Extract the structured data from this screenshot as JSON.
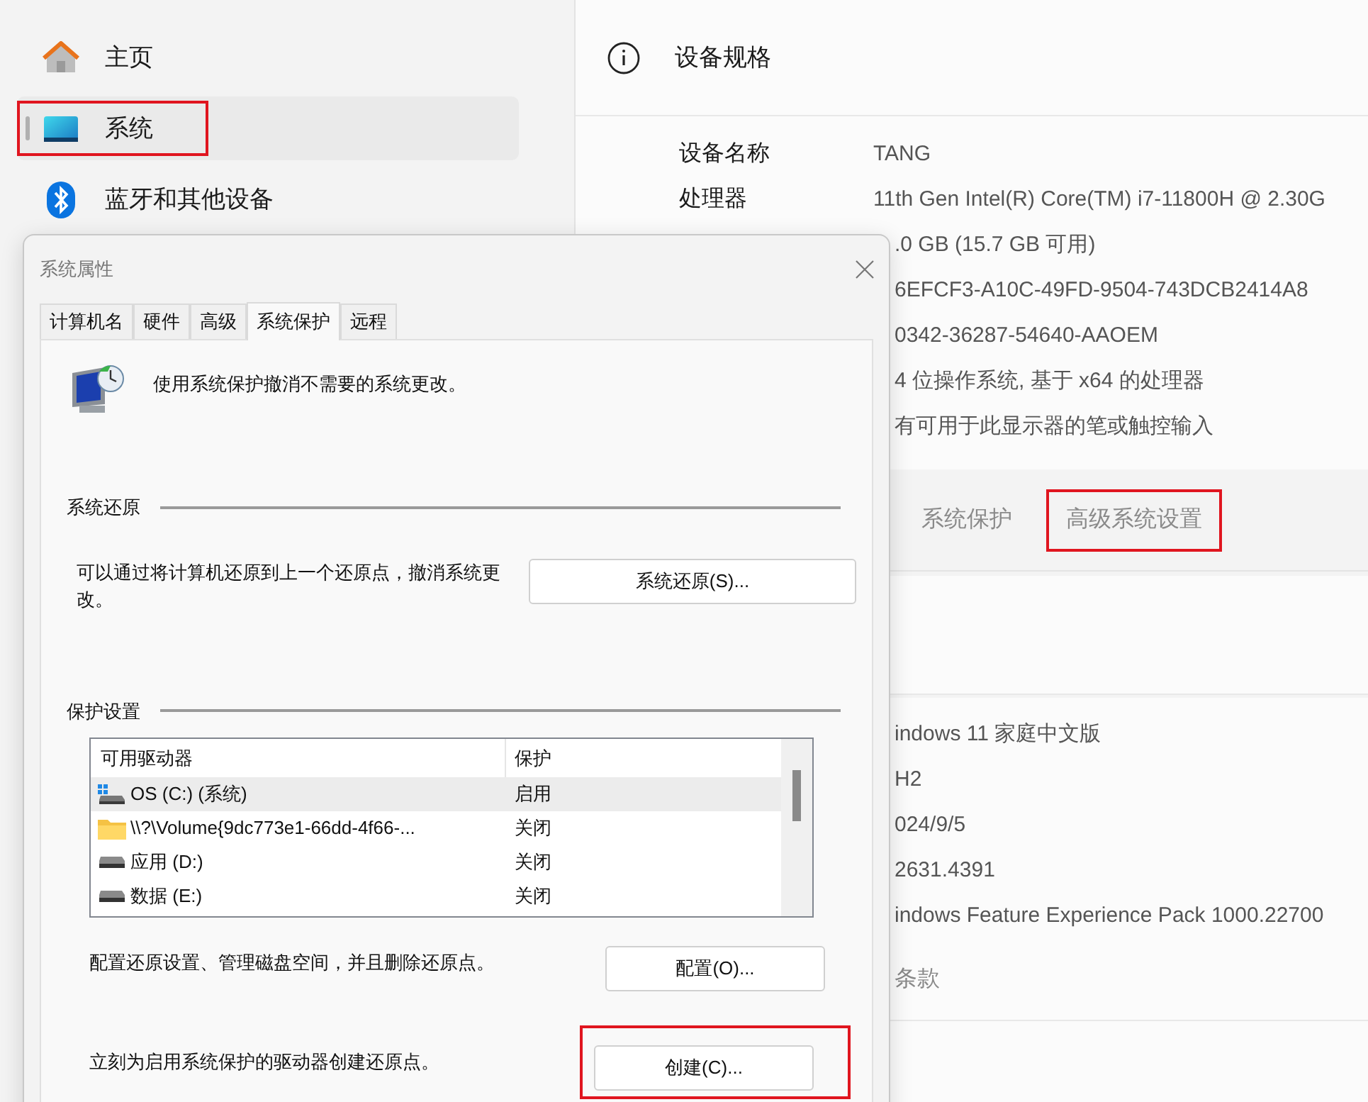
{
  "sidebar": {
    "items": [
      {
        "label": "主页",
        "kind": "home",
        "selected": false,
        "highlighted": false
      },
      {
        "label": "系统",
        "kind": "display",
        "selected": true,
        "highlighted": true
      },
      {
        "label": "蓝牙和其他设备",
        "kind": "bluetooth",
        "selected": false,
        "highlighted": false
      }
    ]
  },
  "spec_card": {
    "title": "设备规格",
    "rows": [
      {
        "label": "设备名称",
        "value": "TANG"
      },
      {
        "label": "处理器",
        "value": "11th Gen Intel(R) Core(TM) i7-11800H @ 2.30G"
      },
      {
        "value": ".0 GB (15.7 GB 可用)"
      },
      {
        "value": "6EFCF3-A10C-49FD-9504-743DCB2414A8"
      },
      {
        "value": "0342-36287-54640-AAOEM"
      },
      {
        "value": "4 位操作系统, 基于 x64 的处理器"
      },
      {
        "value": "有可用于此显示器的笔或触控输入"
      }
    ]
  },
  "related_links": [
    {
      "label": "系统保护",
      "highlighted": false
    },
    {
      "label": "高级系统设置",
      "highlighted": true
    }
  ],
  "windows_spec": {
    "rows": [
      {
        "value": "indows 11 家庭中文版"
      },
      {
        "value": "H2"
      },
      {
        "value": "024/9/5"
      },
      {
        "value": "2631.4391"
      },
      {
        "value": "indows Feature Experience Pack 1000.22700"
      }
    ],
    "link": "条款"
  },
  "dialog": {
    "title": "系统属性",
    "tabs": [
      {
        "label": "计算机名",
        "selected": false
      },
      {
        "label": "硬件",
        "selected": false
      },
      {
        "label": "高级",
        "selected": false
      },
      {
        "label": "系统保护",
        "selected": true
      },
      {
        "label": "远程",
        "selected": false
      }
    ],
    "intro": "使用系统保护撤消不需要的系统更改。",
    "restore_group": {
      "title": "系统还原",
      "text": "可以通过将计算机还原到上一个还原点，撤消系统更改。",
      "button": "系统还原(S)..."
    },
    "protection_group": {
      "title": "保护设置",
      "columns": [
        "可用驱动器",
        "保护"
      ],
      "rows": [
        {
          "drive": "OS (C:) (系统)",
          "kind": "system",
          "protection": "启用",
          "selected": true
        },
        {
          "drive": "\\\\?\\Volume{9dc773e1-66dd-4f66-...",
          "kind": "folder",
          "protection": "关闭",
          "selected": false
        },
        {
          "drive": "应用 (D:)",
          "kind": "drive",
          "protection": "关闭",
          "selected": false
        },
        {
          "drive": "数据 (E:)",
          "kind": "drive",
          "protection": "关闭",
          "selected": false
        }
      ],
      "configure_text": "配置还原设置、管理磁盘空间，并且删除还原点。",
      "configure_button": {
        "label": "配置(O)...",
        "highlighted": false
      },
      "create_text": "立刻为启用系统保护的驱动器创建还原点。",
      "create_button": {
        "label": "创建(C)...",
        "highlighted": true
      }
    }
  }
}
